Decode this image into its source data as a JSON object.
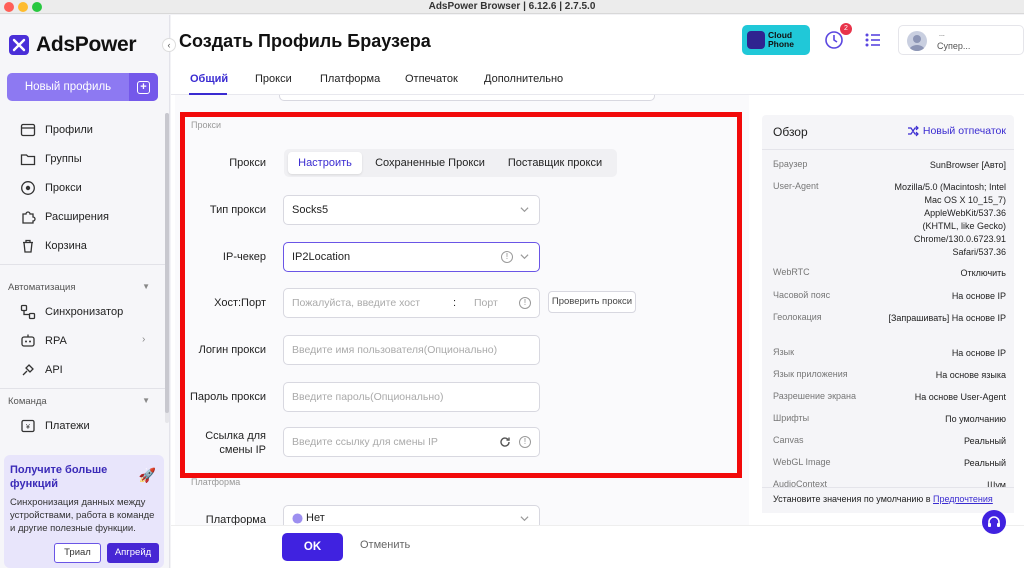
{
  "window": {
    "title": "AdsPower Browser | 6.12.6 | 2.7.5.0"
  },
  "sidebar": {
    "logo_text": "AdsPower",
    "new_profile_label": "Новый профиль",
    "items": [
      {
        "label": "Профили",
        "icon": "profiles-icon"
      },
      {
        "label": "Группы",
        "icon": "folder-icon"
      },
      {
        "label": "Прокси",
        "icon": "globe-icon"
      },
      {
        "label": "Расширения",
        "icon": "puzzle-icon"
      },
      {
        "label": "Корзина",
        "icon": "trash-icon"
      }
    ],
    "automation_section": "Автоматизация",
    "automation_items": [
      {
        "label": "Синхронизатор",
        "icon": "sync-icon"
      },
      {
        "label": "RPA",
        "icon": "rpa-icon"
      },
      {
        "label": "API",
        "icon": "api-icon"
      }
    ],
    "team_section": "Команда",
    "team_items": [
      {
        "label": "Платежи",
        "icon": "payment-icon"
      }
    ],
    "promo": {
      "title": "Получите больше функций",
      "description": "Синхронизация данных между устройствами, работа в команде и другие полезные функции.",
      "trial_label": "Триал",
      "upgrade_label": "Апгрейд"
    }
  },
  "header": {
    "page_title": "Создать Профиль Браузера",
    "cloud_phone_line1": "Cloud",
    "cloud_phone_line2": "Phone",
    "notification_count": "2",
    "user_name": "...",
    "user_role": "Супер..."
  },
  "tabs": [
    "Общий",
    "Прокси",
    "Платформа",
    "Отпечаток",
    "Дополнительно"
  ],
  "proxy": {
    "section_label": "Прокси",
    "row_label": "Прокси",
    "segments": [
      "Настроить",
      "Сохраненные Прокси",
      "Поставщик прокси"
    ],
    "type_label": "Тип прокси",
    "type_value": "Socks5",
    "checker_label": "IP-чекер",
    "checker_value": "IP2Location",
    "hostport_label": "Хост:Порт",
    "host_placeholder": "Пожалуйста, введите хост",
    "port_separator": ":",
    "port_placeholder": "Порт",
    "check_button": "Проверить прокси",
    "login_label": "Логин прокси",
    "login_placeholder": "Введите имя пользователя(Опционально)",
    "password_label": "Пароль прокси",
    "password_placeholder": "Введите пароль(Опционально)",
    "refresh_label_line1": "Ссылка для",
    "refresh_label_line2": "смены IP",
    "refresh_placeholder": "Введите ссылку для смены IP"
  },
  "platform": {
    "section_label": "Платформа",
    "row_label": "Платформа",
    "value": "Нет"
  },
  "footer": {
    "ok_label": "OK",
    "cancel_label": "Отменить"
  },
  "overview": {
    "title": "Обзор",
    "new_fingerprint": "Новый отпечаток",
    "rows": [
      {
        "key": "Браузер",
        "value": "SunBrowser [Авто]"
      },
      {
        "key": "User-Agent",
        "value": "Mozilla/5.0 (Macintosh; Intel Mac OS X 10_15_7) AppleWebKit/537.36 (KHTML, like Gecko) Chrome/130.0.6723.91 Safari/537.36"
      },
      {
        "key": "WebRTC",
        "value": "Отключить"
      },
      {
        "key": "Часовой пояс",
        "value": "На основе IP"
      },
      {
        "key": "Геолокация",
        "value": "[Запрашивать] На основе IP"
      },
      {
        "key": "Язык",
        "value": "На основе IP"
      },
      {
        "key": "Язык приложения",
        "value": "На основе языка"
      },
      {
        "key": "Разрешение экрана",
        "value": "На основе User-Agent"
      },
      {
        "key": "Шрифты",
        "value": "По умолчанию"
      },
      {
        "key": "Canvas",
        "value": "Реальный"
      },
      {
        "key": "WebGL Image",
        "value": "Реальный"
      },
      {
        "key": "AudioContext",
        "value": "Шум"
      }
    ],
    "footer_text": "Установите значения по умолчанию в",
    "footer_link": "Предпочтения"
  }
}
